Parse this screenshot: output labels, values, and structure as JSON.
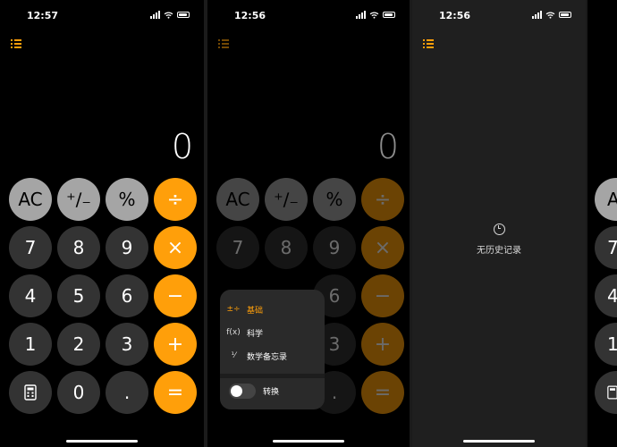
{
  "panels": [
    {
      "status_time": "12:57",
      "display_value": "0"
    },
    {
      "status_time": "12:56",
      "display_value": "0"
    },
    {
      "status_time": "12:56"
    }
  ],
  "keys": {
    "ac": "AC",
    "plus_minus": "⁺∕₋",
    "percent": "%",
    "divide": "÷",
    "seven": "7",
    "eight": "8",
    "nine": "9",
    "multiply": "×",
    "four": "4",
    "five": "5",
    "six": "6",
    "minus": "−",
    "one": "1",
    "two": "2",
    "three": "3",
    "plus": "+",
    "zero": "0",
    "decimal": ".",
    "equals": "="
  },
  "mode_menu": {
    "items": [
      {
        "icon": "±÷",
        "label": "基础",
        "selected": true
      },
      {
        "icon": "f(x)",
        "label": "科学",
        "selected": false
      },
      {
        "icon": "⅟",
        "label": "数学备忘录",
        "selected": false
      }
    ],
    "convert_label": "转换",
    "convert_on": false
  },
  "history": {
    "empty_text": "无历史记录"
  },
  "icons": [
    "menu-list-icon",
    "calculator-icon",
    "clock-icon",
    "signal-icon",
    "wifi-icon",
    "battery-icon",
    "toggle-switch"
  ],
  "colors": {
    "accent": "#ff9f0a",
    "function_key": "#a5a5a5",
    "number_key": "#333333",
    "background": "#000000"
  },
  "peek": {
    "keys": [
      "A",
      "7",
      "4",
      "1"
    ]
  }
}
